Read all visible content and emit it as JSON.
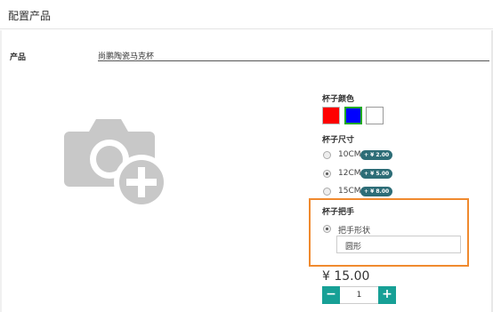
{
  "header": {
    "title": "配置产品"
  },
  "product": {
    "label": "产品",
    "value": "尚鹏陶瓷马克杯"
  },
  "image": {
    "icon": "add-photo-icon"
  },
  "color": {
    "label": "杯子颜色",
    "swatches": [
      {
        "name": "red",
        "hex": "#ff0000",
        "selected": false
      },
      {
        "name": "blue",
        "hex": "#0000ff",
        "selected": true
      },
      {
        "name": "white",
        "hex": "#ffffff",
        "selected": false
      }
    ],
    "selected_border": "#22aa22"
  },
  "size": {
    "label": "杯子尺寸",
    "options": [
      {
        "label": "10CM",
        "price": "+ ¥ 2.00",
        "selected": false
      },
      {
        "label": "12CM",
        "price": "+ ¥ 5.00",
        "selected": true
      },
      {
        "label": "15CM",
        "price": "+ ¥ 8.00",
        "selected": false
      }
    ]
  },
  "handle": {
    "label": "杯子把手",
    "option_label": "把手形状",
    "input_value": "圆形",
    "highlight_color": "#f08a2e"
  },
  "price": "¥ 15.00",
  "quantity": {
    "minus": "−",
    "value": "1",
    "plus": "+"
  },
  "colors": {
    "accent": "#17a096",
    "badge": "#2d6d77"
  }
}
